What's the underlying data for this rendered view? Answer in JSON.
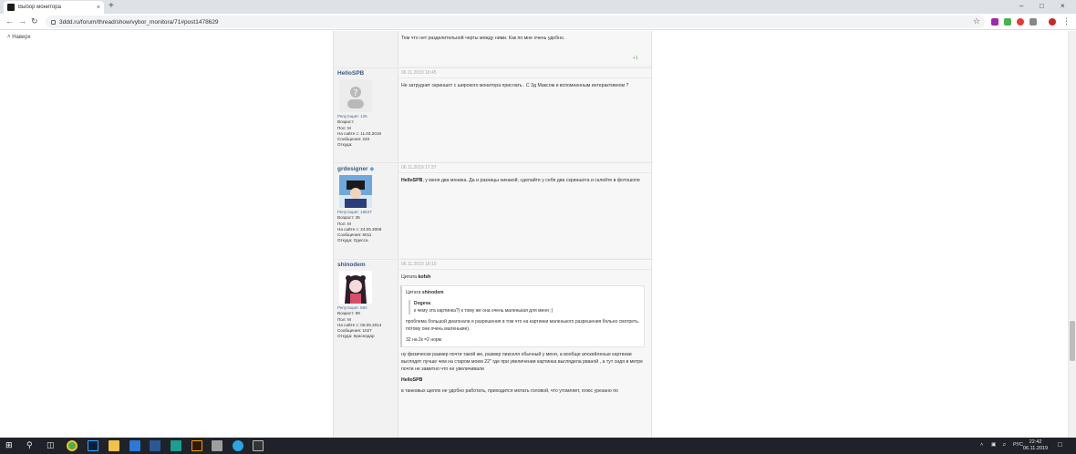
{
  "browser": {
    "tab_title": "Выбор монитора",
    "tab_close": "×",
    "new_tab": "+",
    "url": "3ddd.ru/forum/thread/show/vybor_monitora/71#post1478629",
    "controls": {
      "minimize": "–",
      "maximize": "□",
      "close": "×"
    }
  },
  "page": {
    "back_to_top": "Наверх",
    "posts": [
      {
        "text": "Тем что нет разделительной черты между ними. Как по мне очень удобно.",
        "plus": "+1"
      },
      {
        "user": "HelloSPB",
        "date": "06.11.2019 16:45",
        "reputation": "Репутация: 125",
        "age": "Возраст:",
        "gender": "Пол: М",
        "on_site": "На сайте с: 11.03.2019",
        "messages": "Сообщения: 240",
        "from": "Откуда:",
        "text": "Не затруднит скриншот с широкого  монитора прислать . С 3д Максом и вспомненным интерактивном ?"
      },
      {
        "user": "grdesigner",
        "date": "06.11.2019 17:37",
        "reputation": "Репутация: 16647",
        "age": "Возраст: 35",
        "gender": "Пол: М",
        "on_site": "На сайте с: 24.05.2009",
        "messages": "Сообщения: 6011",
        "from": "Откуда: Одесса",
        "text_bold": "HelloSPB",
        "text": ", у меня два моника. Да и разницы никакой, сделайте у себя два скриншота и склейте в фотошопе"
      },
      {
        "user": "shinodem",
        "date": "06.11.2019 18:10",
        "reputation": "Репутация: 584",
        "age": "Возраст: 99",
        "gender": "Пол: М",
        "on_site": "На сайте с: 06.05.2014",
        "messages": "Сообщения: 1027",
        "from": "Откуда: Краснодар",
        "quote_prefix": "Цитата ",
        "quote_author": "kofsh",
        "nested_quote_prefix": "Цитата ",
        "nested_quote_author": "shinodem",
        "inner_author": "Dogeva",
        "inner_text": "к чему эта картинка?) к тому же она очень маленькая для меня ;)",
        "quote_text": "проблема большой диагонали и разрешения в том что на картинки маленького разрешения больно смотреть. потому они очень маленькие).",
        "quote_text2": "32 на 2к =2 норм",
        "reply_text": "ну физически размер почти такой же, размер пикселя обычный у меня, а вообще апскейленые картинки выглядят лучше чем на старом моем 22\" где при увеличении картинка выглядела рваной , а тут сидя в метре почти не заметно что ее увеличивали",
        "reply_bold": "HelloSPB",
        "reply_text2": "в танковых щелях не удобно работать, приходится мотать головой, что утомляет, плюс урезано по"
      }
    ]
  },
  "taskbar": {
    "language": "РУС",
    "time": "22:42",
    "date": "06.11.2019"
  },
  "colors": {
    "username": "#3a5a86",
    "date": "#a9a9a9",
    "plus": "#6aa84f",
    "taskbar": "#1f2329"
  }
}
